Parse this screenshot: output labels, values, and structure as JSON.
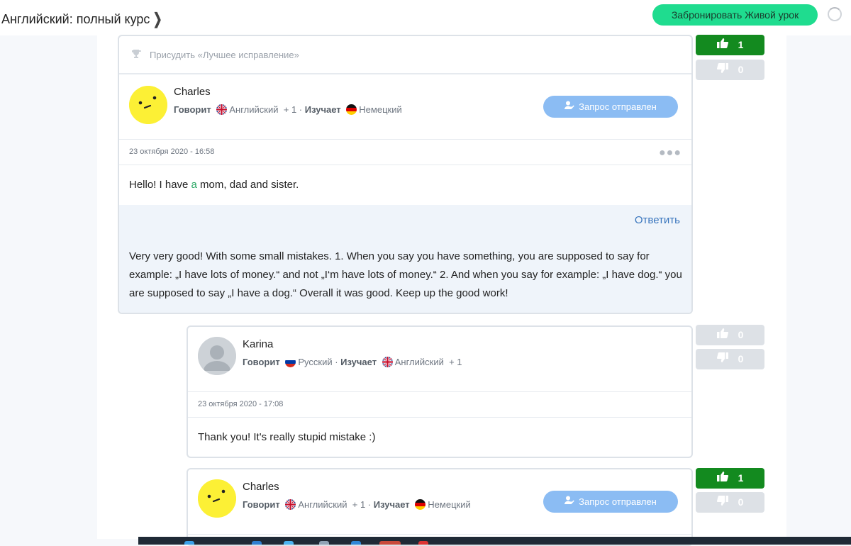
{
  "header": {
    "course_title": "Английский: полный курс",
    "book_button": "Забронировать Живой урок"
  },
  "post1": {
    "award_label": "Присудить «Лучшее исправление»",
    "user_name": "Charles",
    "speaks_label": "Говорит",
    "speaks_lang": "Английский",
    "speaks_extra": "+ 1",
    "learns_label": "Изучает",
    "learns_lang": "Немецкий",
    "request_button": "Запрос отправлен",
    "date": "23 октября 2020 - 16:58",
    "message_before": "Hello! I have ",
    "message_inserted": "a",
    "message_after": " mom, dad and sister.",
    "reply_link": "Ответить",
    "correction": "Very very good! With some small mistakes. 1. When you say you have something, you are supposed to say for example: „I have lots of money.“ and not „I‘m have lots of money.“ 2. And when you say for example: „I have dog.“ you are supposed to say „I have a dog.“ Overall it was good. Keep up the good work!",
    "votes_up": "1",
    "votes_down": "0"
  },
  "post2": {
    "user_name": "Karina",
    "speaks_label": "Говорит",
    "speaks_lang": "Русский",
    "learns_label": "Изучает",
    "learns_lang": "Английский",
    "learns_extra": "+ 1",
    "date": "23 октября 2020 - 17:08",
    "message": "Thank you! It's really stupid mistake :)",
    "votes_up": "0",
    "votes_down": "0"
  },
  "post3": {
    "user_name": "Charles",
    "speaks_label": "Говорит",
    "speaks_lang": "Английский",
    "speaks_extra": "+ 1",
    "learns_label": "Изучает",
    "learns_lang": "Немецкий",
    "request_button": "Запрос отправлен",
    "votes_up": "1",
    "votes_down": "0"
  },
  "icons": {
    "chevron": "chevron-right-icon",
    "spinner": "loading-spinner-icon",
    "trophy": "trophy-icon",
    "user_check": "user-check-icon",
    "thumb_up": "thumb-up-icon",
    "thumb_down": "thumb-down-icon",
    "more": "more-dots-icon",
    "flag_uk": "flag-uk-icon",
    "flag_de": "flag-de-icon",
    "flag_ru": "flag-ru-icon"
  },
  "colors": {
    "accent_green": "#1fdc8f",
    "vote_active": "#138a1f",
    "request_blue": "#8bbcf3",
    "link_blue": "#3975bd",
    "correction_bg": "#eff4fa",
    "inserted_text": "#2aa764"
  }
}
